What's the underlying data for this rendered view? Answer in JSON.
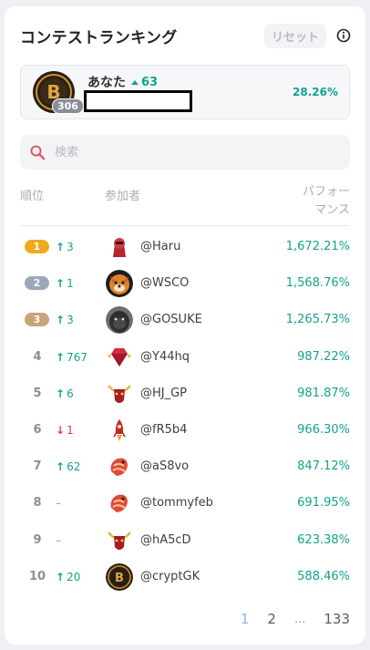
{
  "header": {
    "title": "コンテストランキング",
    "reset_label": "リセット"
  },
  "me": {
    "name": "あなた",
    "change": "63",
    "rank": "306",
    "performance": "28.26%"
  },
  "search": {
    "placeholder": "検索"
  },
  "table": {
    "headers": {
      "rank": "順位",
      "participant": "参加者",
      "performance": "パフォーマンス"
    },
    "rows": [
      {
        "rank": "1",
        "change": "3",
        "direction": "up",
        "name": "@Haru",
        "performance": "1,672.21%",
        "avatar": "red-character"
      },
      {
        "rank": "2",
        "change": "1",
        "direction": "up",
        "name": "@WSCO",
        "performance": "1,568.76%",
        "avatar": "dog"
      },
      {
        "rank": "3",
        "change": "3",
        "direction": "up",
        "name": "@GOSUKE",
        "performance": "1,265.73%",
        "avatar": "gorilla"
      },
      {
        "rank": "4",
        "change": "767",
        "direction": "up",
        "name": "@Y44hq",
        "performance": "987.22%",
        "avatar": "diamond"
      },
      {
        "rank": "5",
        "change": "6",
        "direction": "up",
        "name": "@HJ_GP",
        "performance": "981.87%",
        "avatar": "bull"
      },
      {
        "rank": "6",
        "change": "1",
        "direction": "down",
        "name": "@fR5b4",
        "performance": "966.30%",
        "avatar": "rocket"
      },
      {
        "rank": "7",
        "change": "62",
        "direction": "up",
        "name": "@aS8vo",
        "performance": "847.12%",
        "avatar": "koi"
      },
      {
        "rank": "8",
        "change": "–",
        "direction": "flat",
        "name": "@tommyfeb",
        "performance": "691.95%",
        "avatar": "koi"
      },
      {
        "rank": "9",
        "change": "–",
        "direction": "flat",
        "name": "@hA5cD",
        "performance": "623.38%",
        "avatar": "bull"
      },
      {
        "rank": "10",
        "change": "20",
        "direction": "up",
        "name": "@cryptGK",
        "performance": "588.46%",
        "avatar": "bitcoin"
      }
    ]
  },
  "pagination": {
    "pages": [
      "1",
      "2",
      "...",
      "133"
    ],
    "current": "1"
  },
  "colors": {
    "up": "#14a38b",
    "down": "#e23d3d",
    "gold": "#f0a91c",
    "silver": "#9aa7b8",
    "bronze": "#c9a37a"
  }
}
